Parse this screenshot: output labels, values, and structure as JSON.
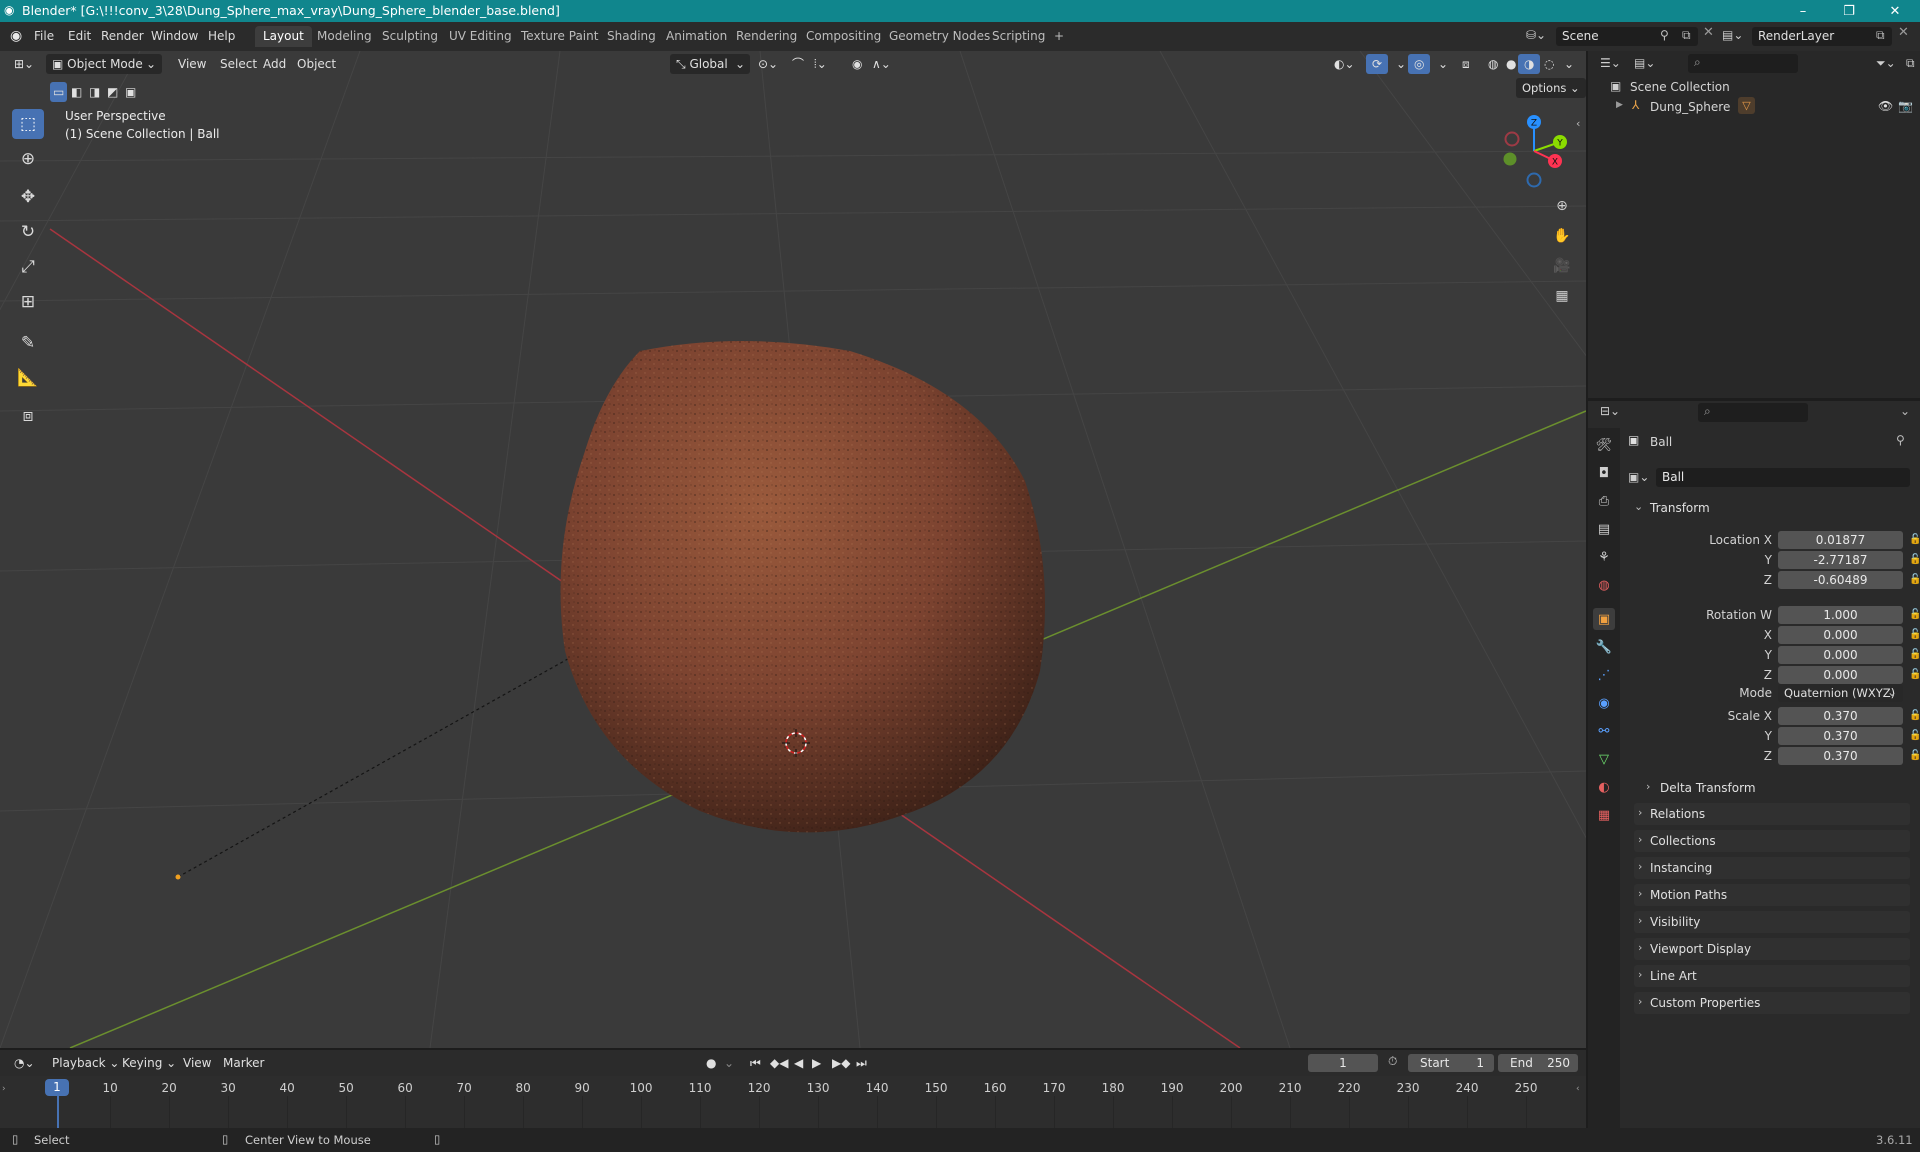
{
  "window": {
    "title": "Blender* [G:\\!!!conv_3\\28\\Dung_Sphere_max_vray\\Dung_Sphere_blender_base.blend]"
  },
  "menu": [
    "File",
    "Edit",
    "Render",
    "Window",
    "Help"
  ],
  "workspaces": [
    "Layout",
    "Modeling",
    "Sculpting",
    "UV Editing",
    "Texture Paint",
    "Shading",
    "Animation",
    "Rendering",
    "Compositing",
    "Geometry Nodes",
    "Scripting",
    "+"
  ],
  "active_workspace": "Layout",
  "scene_name": "Scene",
  "render_layer": "RenderLayer",
  "viewport": {
    "mode": "Object Mode",
    "menu": [
      "View",
      "Select",
      "Add",
      "Object"
    ],
    "orientation": "Global",
    "options_label": "Options",
    "overlay_line1": "User Perspective",
    "overlay_line2": "(1) Scene Collection | Ball",
    "gizmo_axes": [
      "Z",
      "Y",
      "X"
    ],
    "axis_colors": {
      "x": "#ff3352",
      "y": "#8bdc00",
      "z": "#2890ff"
    }
  },
  "outliner": {
    "root": "Scene Collection",
    "items": [
      {
        "label": "Dung_Sphere"
      }
    ]
  },
  "properties": {
    "object_name": "Ball",
    "datablock_name": "Ball",
    "transform_header": "Transform",
    "location": {
      "label": "Location X",
      "x": "0.01877",
      "y": "-2.77187",
      "z": "-0.60489"
    },
    "rotation": {
      "label": "Rotation W",
      "w": "1.000",
      "x": "0.000",
      "y": "0.000",
      "z": "0.000"
    },
    "mode_label": "Mode",
    "mode_value": "Quaternion (WXYZ)",
    "scale": {
      "label": "Scale X",
      "x": "0.370",
      "y": "0.370",
      "z": "0.370"
    },
    "axis_labels": {
      "y": "Y",
      "z": "Z",
      "x": "X"
    },
    "delta": "Delta Transform",
    "sections": [
      "Relations",
      "Collections",
      "Instancing",
      "Motion Paths",
      "Visibility",
      "Viewport Display",
      "Line Art",
      "Custom Properties"
    ]
  },
  "timeline": {
    "menu": [
      "Playback",
      "Keying",
      "View",
      "Marker"
    ],
    "current_frame": "1",
    "start_label": "Start",
    "start": "1",
    "end_label": "End",
    "end": "250",
    "ticks": [
      "1",
      "10",
      "20",
      "30",
      "40",
      "50",
      "60",
      "70",
      "80",
      "90",
      "100",
      "110",
      "120",
      "130",
      "140",
      "150",
      "160",
      "170",
      "180",
      "190",
      "200",
      "210",
      "220",
      "230",
      "240",
      "250"
    ]
  },
  "status": {
    "select": "Select",
    "center": "Center View to Mouse",
    "version": "3.6.11"
  }
}
